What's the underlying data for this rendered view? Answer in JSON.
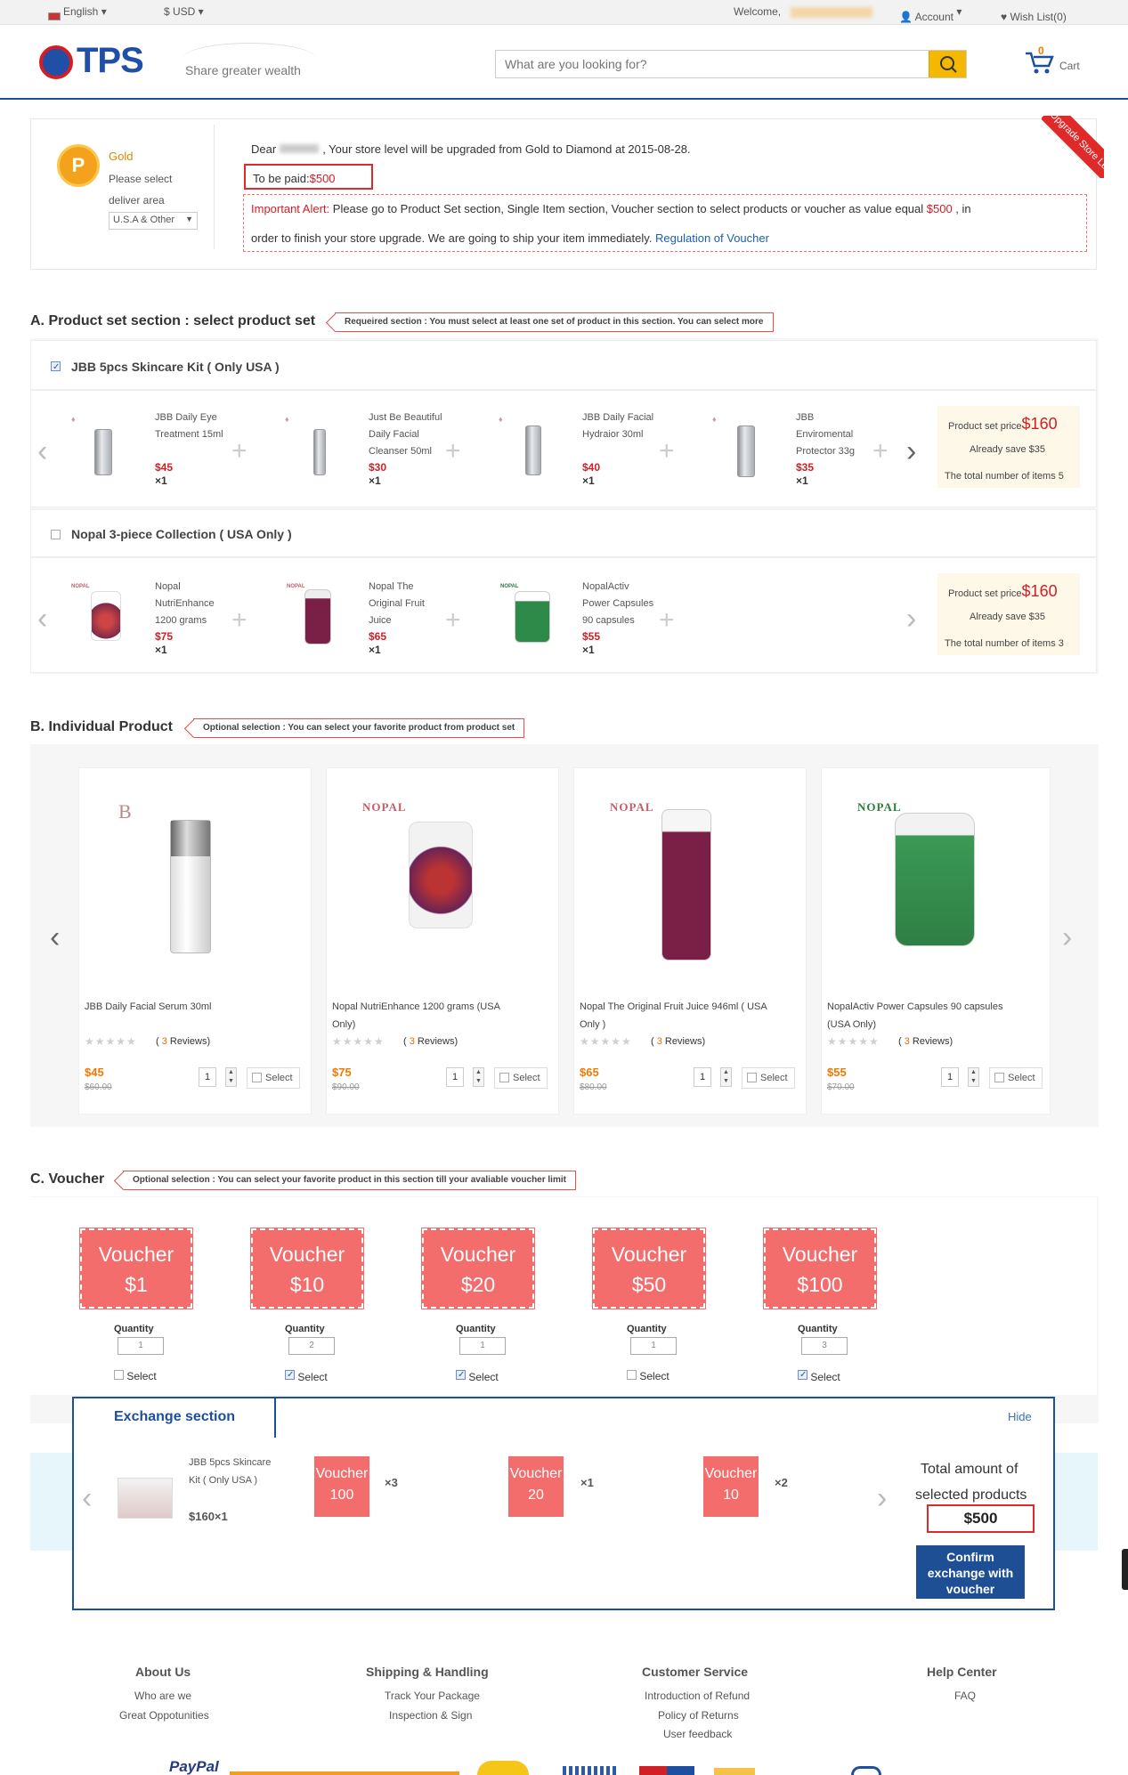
{
  "topbar": {
    "language": "English",
    "currency": "$ USD",
    "welcome": "Welcome,",
    "account": "Account",
    "wishlist": "Wish List(0)"
  },
  "header": {
    "logo": "TPS",
    "slogan": "Share greater wealth",
    "search_placeholder": "What are you looking for?",
    "cart_label": "Cart",
    "cart_count": "0"
  },
  "upgrade": {
    "level": "Gold",
    "select_text1": "Please select",
    "select_text2": "deliver area",
    "area_value": "U.S.A & Other",
    "dear": "Dear",
    "message": ", Your store level will be upgraded from Gold to Diamond at 2015-08-28.",
    "to_be_paid_label": "To be paid:",
    "to_be_paid_value": "$500",
    "alert_label": "Important Alert:",
    "alert_text1": " Please go to Product Set section, Single Item section, Voucher section to select products or voucher as value equal ",
    "alert_amount": "$500",
    "alert_text2": " , in",
    "alert_text3": "order to finish your store upgrade. We are going to ship your item immediately.",
    "alert_link": "Regulation of Voucher",
    "ribbon": "Upgrade Store Level"
  },
  "section_a": {
    "title": "A. Product set section : select product set",
    "tag": "Requeired section : You must select at least one set of product in this section. You can select more",
    "sets": [
      {
        "name": "JBB 5pcs Skincare Kit ( Only USA )",
        "checked": true,
        "items": [
          {
            "l1": "JBB Daily Eye",
            "l2": "Treatment 15ml",
            "l3": "",
            "price": "$45",
            "qty": "×1"
          },
          {
            "l1": "Just Be Beautiful",
            "l2": "Daily Facial",
            "l3": "Cleanser 50ml",
            "price": "$30",
            "qty": "×1"
          },
          {
            "l1": "JBB Daily Facial",
            "l2": "Hydraior 30ml",
            "l3": "",
            "price": "$40",
            "qty": "×1"
          },
          {
            "l1": "JBB",
            "l2": "Enviromental",
            "l3": "Protector 33g",
            "price": "$35",
            "qty": "×1"
          }
        ],
        "price_label": "Product set price",
        "price": "$160",
        "save": "Already save $35",
        "total": "The total number of items 5"
      },
      {
        "name": "Nopal 3-piece Collection ( USA Only )",
        "checked": false,
        "items": [
          {
            "l1": "Nopal",
            "l2": "NutriEnhance",
            "l3": "1200 grams",
            "price": "$75",
            "qty": "×1"
          },
          {
            "l1": "Nopal The",
            "l2": "Original Fruit",
            "l3": "Juice",
            "price": "$65",
            "qty": "×1"
          },
          {
            "l1": "NopalActiv",
            "l2": "Power Capsules",
            "l3": "90 capsules",
            "price": "$55",
            "qty": "×1"
          }
        ],
        "price_label": "Product set price",
        "price": "$160",
        "save": "Already save $35",
        "total": "The total number of items 3"
      }
    ]
  },
  "section_b": {
    "title": "B. Individual Product",
    "tag": "Optional selection : You can select your favorite product from product set",
    "products": [
      {
        "n1": "JBB Daily Facial Serum 30ml",
        "n2": "",
        "reviews_prefix": "(",
        "reviews": "3",
        "reviews_suffix": "Reviews)",
        "price": "$45",
        "old": "$60.00",
        "qty": "1",
        "select": "Select"
      },
      {
        "n1": "Nopal NutriEnhance 1200 grams (USA",
        "n2": "Only)",
        "reviews_prefix": "(",
        "reviews": "3",
        "reviews_suffix": "Reviews)",
        "price": "$75",
        "old": "$90.00",
        "qty": "1",
        "select": "Select"
      },
      {
        "n1": "Nopal The Original Fruit Juice 946ml ( USA",
        "n2": "Only )",
        "reviews_prefix": "(",
        "reviews": "3",
        "reviews_suffix": "Reviews)",
        "price": "$65",
        "old": "$80.00",
        "qty": "1",
        "select": "Select"
      },
      {
        "n1": "NopalActiv Power Capsules 90 capsules",
        "n2": "(USA Only)",
        "reviews_prefix": "(",
        "reviews": "3",
        "reviews_suffix": "Reviews)",
        "price": "$55",
        "old": "$70.00",
        "qty": "1",
        "select": "Select"
      }
    ],
    "nopal": "NOPAL"
  },
  "section_c": {
    "title": "C. Voucher",
    "tag": "Optional selection : You can select your favorite product in this section till your avaliable voucher limit",
    "vouchers": [
      {
        "label": "Voucher",
        "value": "$1",
        "qty_label": "Quantity",
        "qty": "1",
        "select": "Select",
        "checked": false
      },
      {
        "label": "Voucher",
        "value": "$10",
        "qty_label": "Quantity",
        "qty": "2",
        "select": "Select",
        "checked": true
      },
      {
        "label": "Voucher",
        "value": "$20",
        "qty_label": "Quantity",
        "qty": "1",
        "select": "Select",
        "checked": true
      },
      {
        "label": "Voucher",
        "value": "$50",
        "qty_label": "Quantity",
        "qty": "1",
        "select": "Select",
        "checked": false
      },
      {
        "label": "Voucher",
        "value": "$100",
        "qty_label": "Quantity",
        "qty": "3",
        "select": "Select",
        "checked": true
      }
    ]
  },
  "exchange": {
    "title": "Exchange section",
    "hide": "Hide",
    "set_l1": "JBB 5pcs Skincare",
    "set_l2": "Kit ( Only USA )",
    "set_price": "$160×1",
    "vouchers": [
      {
        "label": "Voucher",
        "value": "100",
        "qty": "×3"
      },
      {
        "label": "Voucher",
        "value": "20",
        "qty": "×1"
      },
      {
        "label": "Voucher",
        "value": "10",
        "qty": "×2"
      }
    ],
    "total_l1": "Total amount of",
    "total_l2": "selected products",
    "total": "$500",
    "confirm": "Confirm exchange with voucher"
  },
  "footer": {
    "cols": [
      {
        "title": "About Us",
        "links": [
          "Who are we",
          "Great Oppotunities"
        ]
      },
      {
        "title": "Shipping & Handling",
        "links": [
          "Track Your Package",
          "Inspection & Sign"
        ]
      },
      {
        "title": "Customer Service",
        "links": [
          "Introduction of Refund",
          "Policy of Returns",
          "User feedback"
        ]
      },
      {
        "title": "Help Center",
        "links": [
          "FAQ"
        ]
      }
    ],
    "paypal": "PayPal"
  },
  "colors": {
    "brand": "#1d4fa0",
    "accent": "#f5b800",
    "red": "#d41d24",
    "voucher": "#f46d6d"
  }
}
